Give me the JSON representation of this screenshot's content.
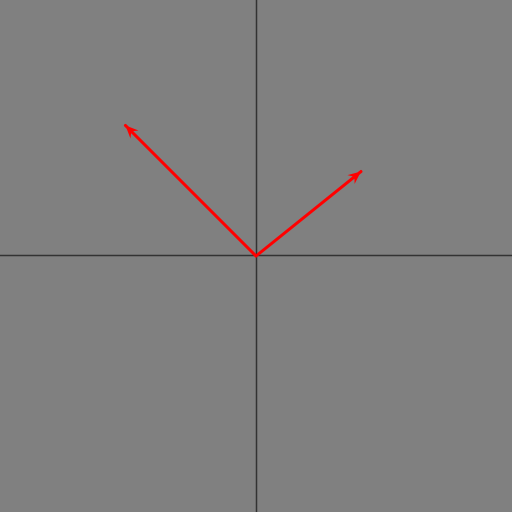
{
  "colors": {
    "background": "#808080",
    "axis": "#333333",
    "vector": "#ff0000"
  },
  "vectors": [
    {
      "label": "",
      "dx": -0.51,
      "dy": 0.51
    },
    {
      "label": "",
      "dx": 0.41,
      "dy": 0.33
    }
  ]
}
